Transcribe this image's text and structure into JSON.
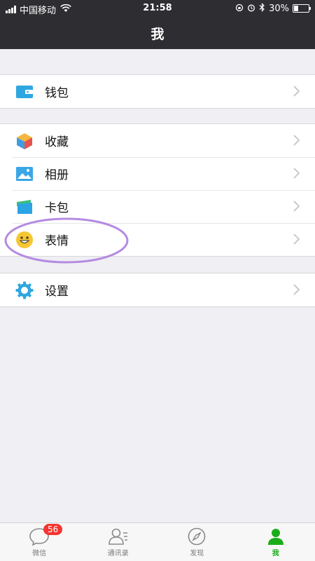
{
  "status_bar": {
    "carrier": "中国移动",
    "time": "21:58",
    "battery": "30%",
    "battery_level": 0.3
  },
  "nav": {
    "title": "我"
  },
  "groups": [
    {
      "items": [
        {
          "label": "钱包",
          "icon": "wallet-icon"
        }
      ]
    },
    {
      "items": [
        {
          "label": "收藏",
          "icon": "favorites-icon"
        },
        {
          "label": "相册",
          "icon": "album-icon"
        },
        {
          "label": "卡包",
          "icon": "card-pack-icon"
        },
        {
          "label": "表情",
          "icon": "sticker-icon"
        }
      ]
    },
    {
      "items": [
        {
          "label": "设置",
          "icon": "settings-icon"
        }
      ]
    }
  ],
  "tabbar": {
    "tabs": [
      {
        "label": "微信",
        "icon": "chat-icon",
        "badge": "56"
      },
      {
        "label": "通讯录",
        "icon": "contacts-icon"
      },
      {
        "label": "发现",
        "icon": "discover-icon"
      },
      {
        "label": "我",
        "icon": "me-icon",
        "active": true
      }
    ]
  },
  "colors": {
    "nav_bg": "#2e2e32",
    "accent_green": "#1aad19",
    "badge_red": "#f43530",
    "highlight_purple": "#b58be0"
  }
}
